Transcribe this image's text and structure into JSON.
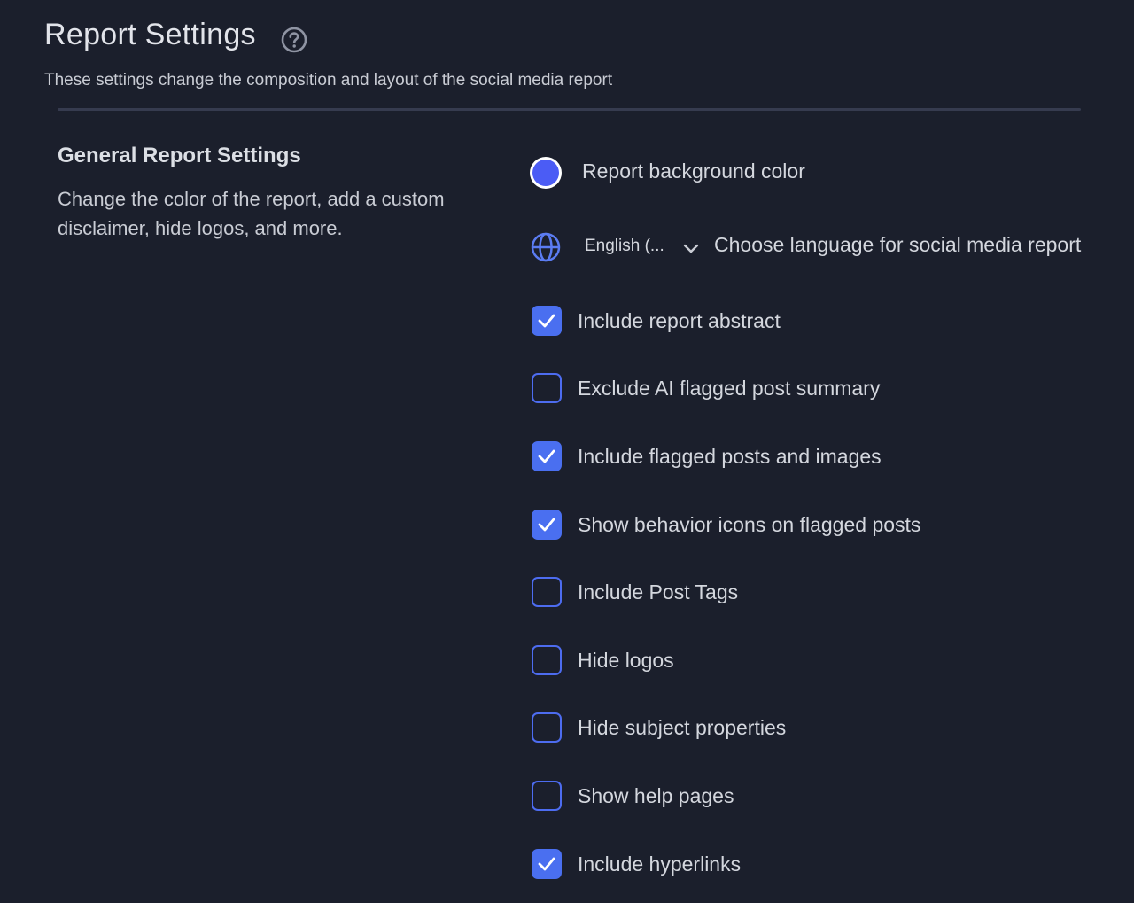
{
  "header": {
    "title": "Report Settings",
    "subtitle": "These settings change the composition and layout of the social media report"
  },
  "section": {
    "title": "General Report Settings",
    "description": "Change the color of the report, add a custom disclaimer, hide logos, and more."
  },
  "background_color": {
    "label": "Report background color",
    "value": "#4b5cf5"
  },
  "language": {
    "selected": "English (...",
    "label": "Choose language for social media report"
  },
  "options": [
    {
      "label": "Include report abstract",
      "checked": true
    },
    {
      "label": "Exclude AI flagged post summary",
      "checked": false
    },
    {
      "label": "Include flagged posts and images",
      "checked": true
    },
    {
      "label": "Show behavior icons on flagged posts",
      "checked": true
    },
    {
      "label": "Include Post Tags",
      "checked": false
    },
    {
      "label": "Hide logos",
      "checked": false
    },
    {
      "label": "Hide subject properties",
      "checked": false
    },
    {
      "label": "Show help pages",
      "checked": false
    },
    {
      "label": "Include hyperlinks",
      "checked": true
    }
  ],
  "colors": {
    "background": "#1b1f2c",
    "accent": "#4a6ff0",
    "divider": "#363b4f"
  },
  "icons": {
    "help": "help-circle-icon",
    "globe": "globe-icon",
    "chevron": "chevron-down-icon",
    "check": "checkmark-icon"
  }
}
